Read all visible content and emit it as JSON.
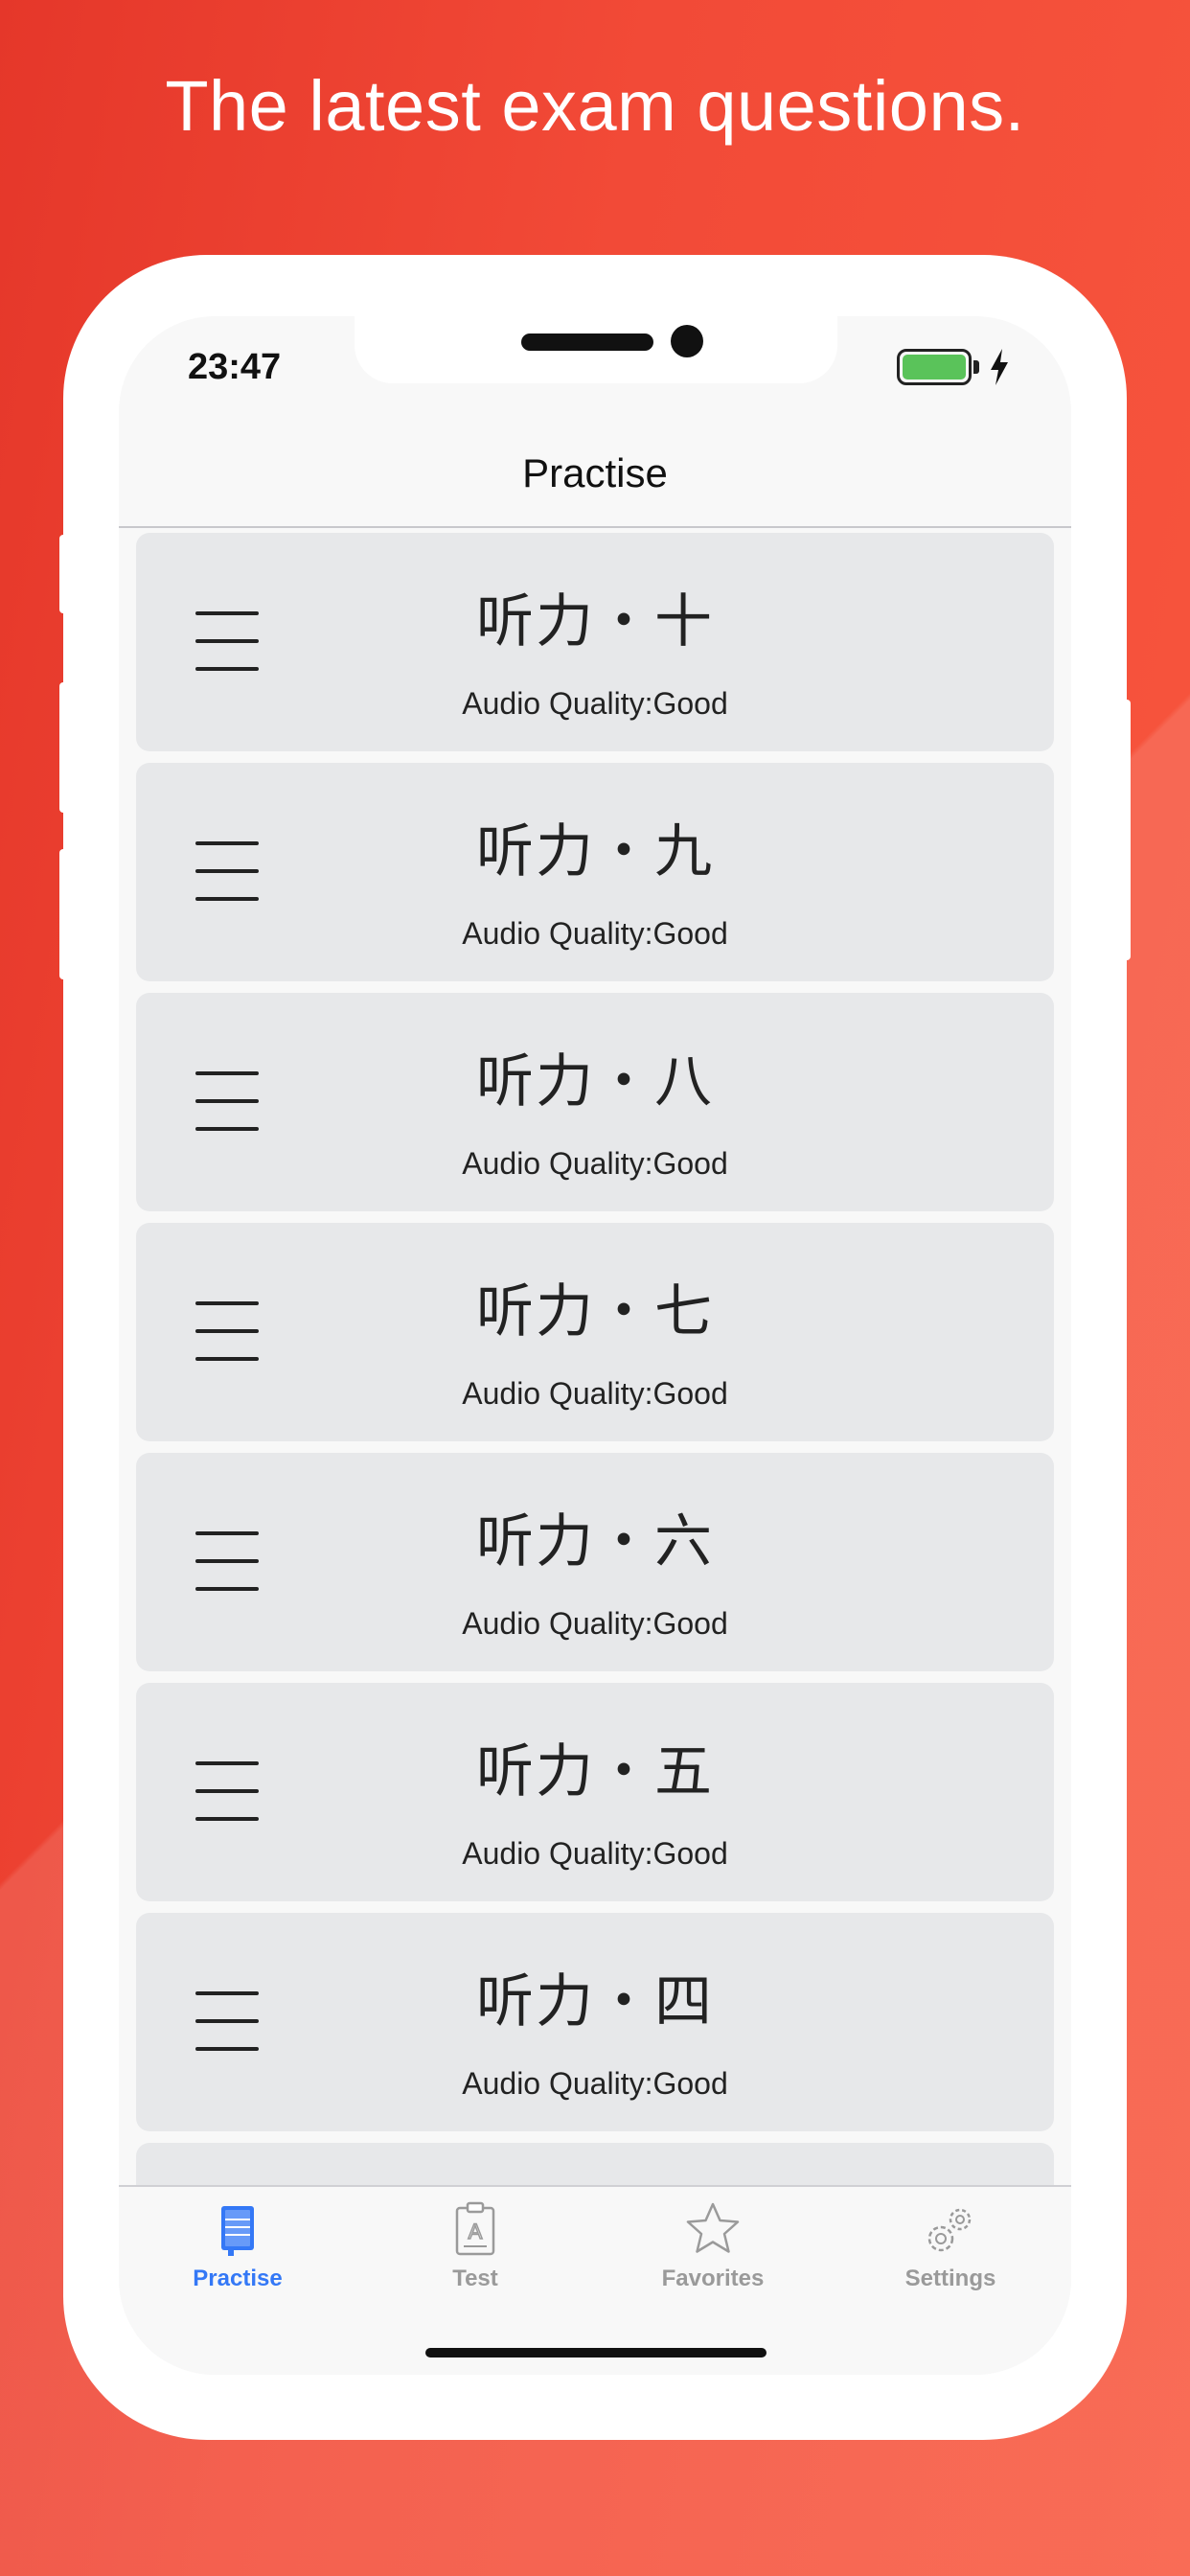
{
  "headline": "The latest exam questions.",
  "status_bar": {
    "time": "23:47"
  },
  "nav": {
    "title": "Practise"
  },
  "items": [
    {
      "title": "听力・十",
      "subtitle": "Audio Quality:Good"
    },
    {
      "title": "听力・九",
      "subtitle": "Audio Quality:Good"
    },
    {
      "title": "听力・八",
      "subtitle": "Audio Quality:Good"
    },
    {
      "title": "听力・七",
      "subtitle": "Audio Quality:Good"
    },
    {
      "title": "听力・六",
      "subtitle": "Audio Quality:Good"
    },
    {
      "title": "听力・五",
      "subtitle": "Audio Quality:Good"
    },
    {
      "title": "听力・四",
      "subtitle": "Audio Quality:Good"
    }
  ],
  "tabs": [
    {
      "label": "Practise",
      "icon": "notebook-icon",
      "active": true
    },
    {
      "label": "Test",
      "icon": "clipboard-icon",
      "active": false
    },
    {
      "label": "Favorites",
      "icon": "star-icon",
      "active": false
    },
    {
      "label": "Settings",
      "icon": "gear-icon",
      "active": false
    }
  ],
  "colors": {
    "accent": "#3478f6",
    "background": "#f24a37",
    "card": "#e7e8ea",
    "battery": "#5ac35a"
  }
}
